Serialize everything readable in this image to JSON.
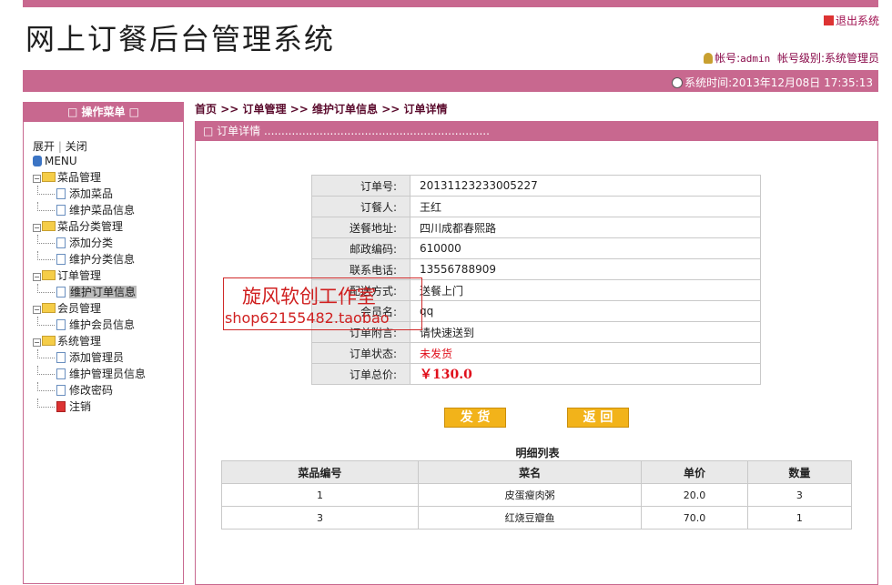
{
  "header": {
    "title": "网上订餐后台管理系统",
    "logout_label": "退出系统",
    "account_prefix": "帐号:",
    "account_name": "admin",
    "level_prefix": "帐号级别:",
    "level_value": "系统管理员",
    "time_label": "系统时间:2013年12月08日 17:35:13"
  },
  "sidebar": {
    "title": "□ 操作菜单 □",
    "expand": "展开",
    "separator": "|",
    "collapse": "关闭",
    "menu_root": "MENU",
    "groups": [
      {
        "label": "菜品管理",
        "items": [
          "添加菜品",
          "维护菜品信息"
        ]
      },
      {
        "label": "菜品分类管理",
        "items": [
          "添加分类",
          "维护分类信息"
        ]
      },
      {
        "label": "订单管理",
        "items": [
          "维护订单信息"
        ]
      },
      {
        "label": "会员管理",
        "items": [
          "维护会员信息"
        ]
      },
      {
        "label": "系统管理",
        "items": [
          "添加管理员",
          "维护管理员信息",
          "修改密码"
        ]
      }
    ],
    "logout": "注销"
  },
  "breadcrumb": {
    "home": "首页",
    "sep": ">>",
    "level1": "订单管理",
    "level2": "维护订单信息",
    "level3": "订单详情"
  },
  "panel": {
    "title": "□ 订单详情 .................................................................",
    "fields": [
      {
        "label": "订单号:",
        "value": "20131123233005227"
      },
      {
        "label": "订餐人:",
        "value": "王红"
      },
      {
        "label": "送餐地址:",
        "value": "四川成都春熙路"
      },
      {
        "label": "邮政编码:",
        "value": "610000"
      },
      {
        "label": "联系电话:",
        "value": "13556788909"
      },
      {
        "label": "配送方式:",
        "value": "送餐上门"
      },
      {
        "label": "会员名:",
        "value": "qq"
      },
      {
        "label": "订单附言:",
        "value": "请快速送到"
      },
      {
        "label": "订单状态:",
        "value": "未发货"
      },
      {
        "label": "订单总价:",
        "value": "￥130.0"
      }
    ],
    "ship_button": "发 货",
    "back_button": "返 回",
    "items_title": "明细列表",
    "items_headers": [
      "菜品编号",
      "菜名",
      "单价",
      "数量"
    ],
    "items_rows": [
      [
        "1",
        "皮蛋瘦肉粥",
        "20.0",
        "3"
      ],
      [
        "3",
        "红烧豆瓣鱼",
        "70.0",
        "1"
      ]
    ]
  },
  "watermark": {
    "line1": "旋风软创工作室",
    "line2": "shop62155482.taobao"
  },
  "colors": {
    "accent": "#c8688f",
    "button": "#f2b31a",
    "alert": "#e0101c"
  }
}
